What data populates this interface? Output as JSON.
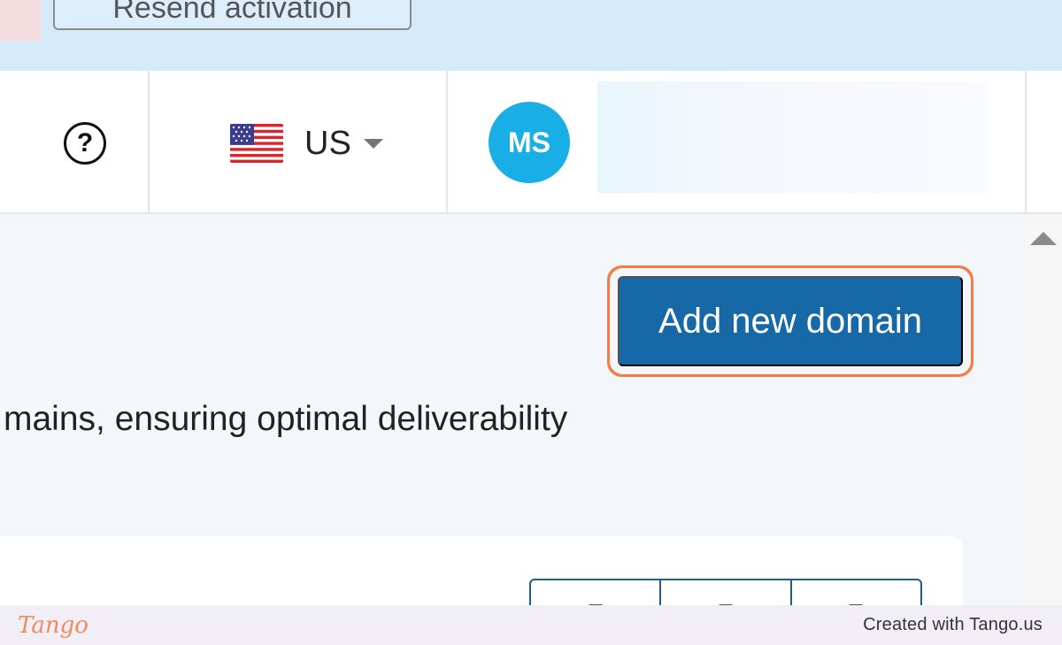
{
  "banner": {
    "resend_label": "Resend activation"
  },
  "header": {
    "help_icon": "question-circle-icon",
    "help_glyph": "?",
    "language": {
      "flag_icon": "us-flag-icon",
      "label": "US",
      "caret_icon": "caret-down-icon"
    },
    "user": {
      "initials": "MS"
    }
  },
  "main": {
    "add_domain_label": "Add new domain",
    "description": "mains, ensuring optimal deliverability"
  },
  "footer": {
    "logo": "Tango",
    "created_with": "Created with Tango.us"
  },
  "colors": {
    "banner_bg": "#d6ebfa",
    "primary_button": "#1669a6",
    "highlight_outline": "#f47c48",
    "avatar_bg": "#1aaee6",
    "tango_orange": "#f08a5d"
  }
}
